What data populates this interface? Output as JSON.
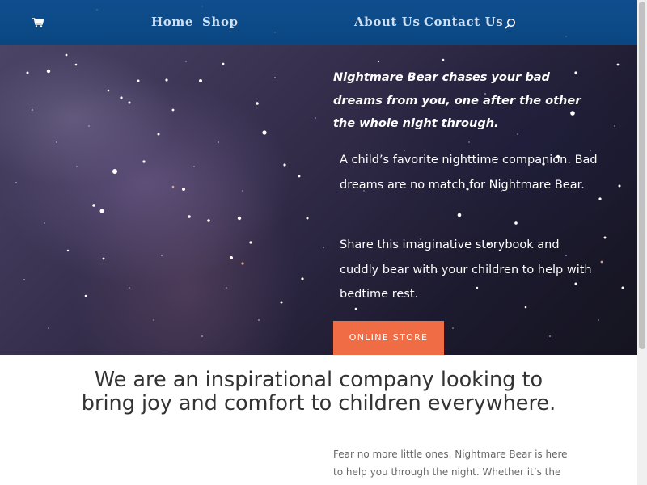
{
  "header": {
    "nav_left": [
      {
        "label": "Home"
      },
      {
        "label": "Shop"
      }
    ],
    "nav_right": [
      {
        "label": "About Us"
      },
      {
        "label": "Contact Us"
      }
    ],
    "icons": {
      "cart": "cart-icon",
      "search": "search-icon"
    }
  },
  "hero": {
    "quote": "Nightmare Bear chases your bad dreams from you, one after the other the whole night through.",
    "paragraph1": "A child’s favorite nighttime companion. Bad dreams are no match for Nightmare Bear.",
    "paragraph2": "Share this imaginative storybook and cuddly bear with your children to help with bedtime rest.",
    "button_label": "ONLINE STORE"
  },
  "content": {
    "tagline": "We are an inspirational company looking to bring joy and comfort to children everywhere.",
    "body": "Fear no more little ones. Nightmare Bear is here to help you through the night. Whether it’s the bump in the"
  },
  "colors": {
    "header_bg": "#0c4a87",
    "nav_text": "#cfe0f5",
    "button_bg": "#ef6c45",
    "tagline_text": "#333333",
    "body_text": "#666666"
  }
}
